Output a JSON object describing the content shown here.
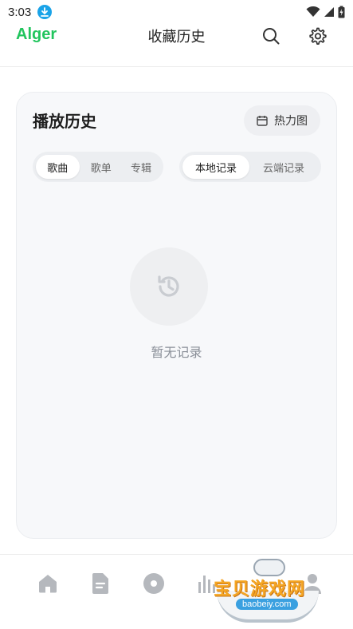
{
  "status_bar": {
    "time": "3:03",
    "icons": [
      "download-badge-icon",
      "wifi-icon",
      "signal-icon",
      "battery-charging-icon"
    ]
  },
  "header": {
    "brand": "Alger",
    "title": "收藏历史",
    "icons": [
      "search-icon",
      "gear-icon"
    ]
  },
  "history_card": {
    "title": "播放历史",
    "heatmap_label": "热力图",
    "type_tabs": [
      {
        "label": "歌曲",
        "active": true
      },
      {
        "label": "歌单",
        "active": false
      },
      {
        "label": "专辑",
        "active": false
      }
    ],
    "source_tabs": [
      {
        "label": "本地记录",
        "active": true
      },
      {
        "label": "云端记录",
        "active": false
      }
    ],
    "empty_text": "暂无记录"
  },
  "bottom_nav": {
    "items": [
      "home-icon",
      "document-icon",
      "disc-icon",
      "chart-bars-icon",
      "user-icon"
    ]
  },
  "watermark": {
    "title": "宝贝游戏网",
    "url": "baobeiy.com"
  },
  "colors": {
    "brand": "#22c55e",
    "download_badge": "#1aa3e8",
    "muted_text": "#8a8f98",
    "card_bg": "#f7f8fa"
  }
}
